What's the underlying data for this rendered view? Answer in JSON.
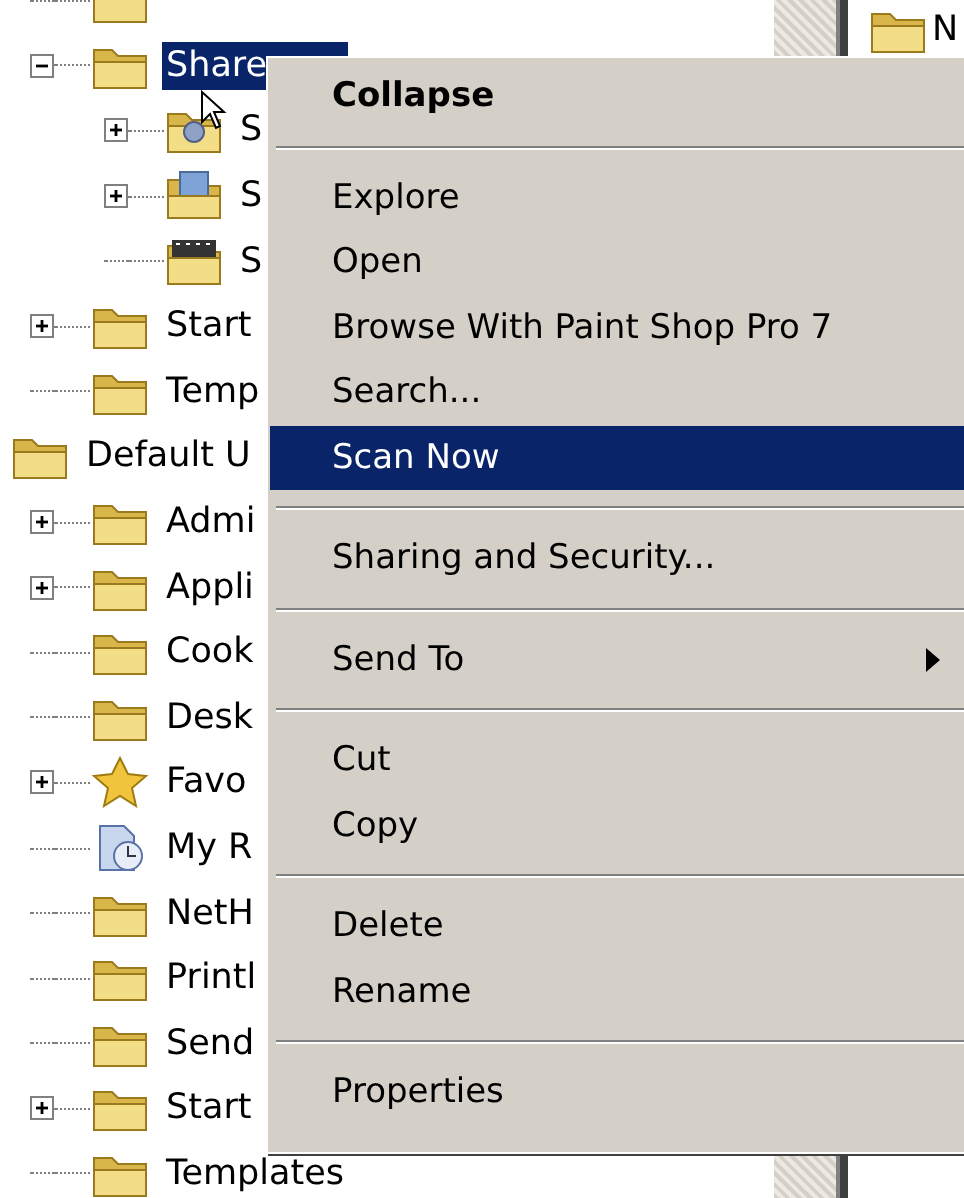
{
  "tree": {
    "items": [
      {
        "children": [
          {
            "kind": "folder"
          },
          {
            "kind": "folder",
            "label": "Share",
            "expanded": true,
            "selected": true,
            "children": [
              {
                "kind": "shared",
                "label": "S",
                "expanded": false,
                "selected": false
              },
              {
                "kind": "pictures",
                "label": "S",
                "expanded": false,
                "selected": false
              },
              {
                "kind": "video",
                "label": "S",
                "selected": false
              }
            ]
          },
          {
            "kind": "folder",
            "label": "Start",
            "expanded": false,
            "selected": false
          },
          {
            "kind": "folder",
            "label": "Temp",
            "selected": false
          }
        ]
      },
      {
        "kind": "folder",
        "label": "Default U",
        "selected": false,
        "children": [
          {
            "kind": "folder",
            "label": "Admi",
            "expanded": false,
            "selected": false
          },
          {
            "kind": "folder",
            "label": "Appli",
            "expanded": false,
            "selected": false
          },
          {
            "kind": "folder",
            "label": "Cook",
            "selected": false
          },
          {
            "kind": "folder",
            "label": "Desk",
            "selected": false
          },
          {
            "kind": "star",
            "label": "Favo",
            "expanded": false,
            "selected": false
          },
          {
            "kind": "history",
            "label": "My R",
            "selected": false
          },
          {
            "kind": "folder",
            "label": "NetH",
            "selected": false
          },
          {
            "kind": "folder",
            "label": "Printl",
            "selected": false
          },
          {
            "kind": "folder",
            "label": "Send",
            "selected": false
          },
          {
            "kind": "folder",
            "label": "Start",
            "expanded": false,
            "selected": false
          },
          {
            "kind": "folder",
            "label": "Templates",
            "selected": false
          }
        ]
      }
    ]
  },
  "right_pane": {
    "items": [
      {
        "kind": "folder",
        "label": "N"
      }
    ]
  },
  "context_menu": {
    "items": [
      {
        "kind": "item",
        "label": "Collapse",
        "default": true,
        "submenu": false,
        "selected": false
      },
      {
        "kind": "separator"
      },
      {
        "kind": "item",
        "label": "Explore",
        "default": false,
        "submenu": false,
        "selected": false
      },
      {
        "kind": "item",
        "label": "Open",
        "default": false,
        "submenu": false,
        "selected": false
      },
      {
        "kind": "item",
        "label": "Browse With Paint Shop Pro 7",
        "default": false,
        "submenu": false,
        "selected": false
      },
      {
        "kind": "item",
        "label": "Search...",
        "default": false,
        "submenu": false,
        "selected": false
      },
      {
        "kind": "item",
        "label": "Scan Now",
        "default": false,
        "submenu": false,
        "selected": true
      },
      {
        "kind": "separator"
      },
      {
        "kind": "item",
        "label": "Sharing and Security...",
        "default": false,
        "submenu": false,
        "selected": false
      },
      {
        "kind": "separator"
      },
      {
        "kind": "item",
        "label": "Send To",
        "default": false,
        "submenu": true,
        "selected": false
      },
      {
        "kind": "separator"
      },
      {
        "kind": "item",
        "label": "Cut",
        "default": false,
        "submenu": false,
        "selected": false
      },
      {
        "kind": "item",
        "label": "Copy",
        "default": false,
        "submenu": false,
        "selected": false
      },
      {
        "kind": "separator"
      },
      {
        "kind": "item",
        "label": "Delete",
        "default": false,
        "submenu": false,
        "selected": false
      },
      {
        "kind": "item",
        "label": "Rename",
        "default": false,
        "submenu": false,
        "selected": false
      },
      {
        "kind": "separator"
      },
      {
        "kind": "item",
        "label": "Properties",
        "default": false,
        "submenu": false,
        "selected": false
      }
    ]
  }
}
